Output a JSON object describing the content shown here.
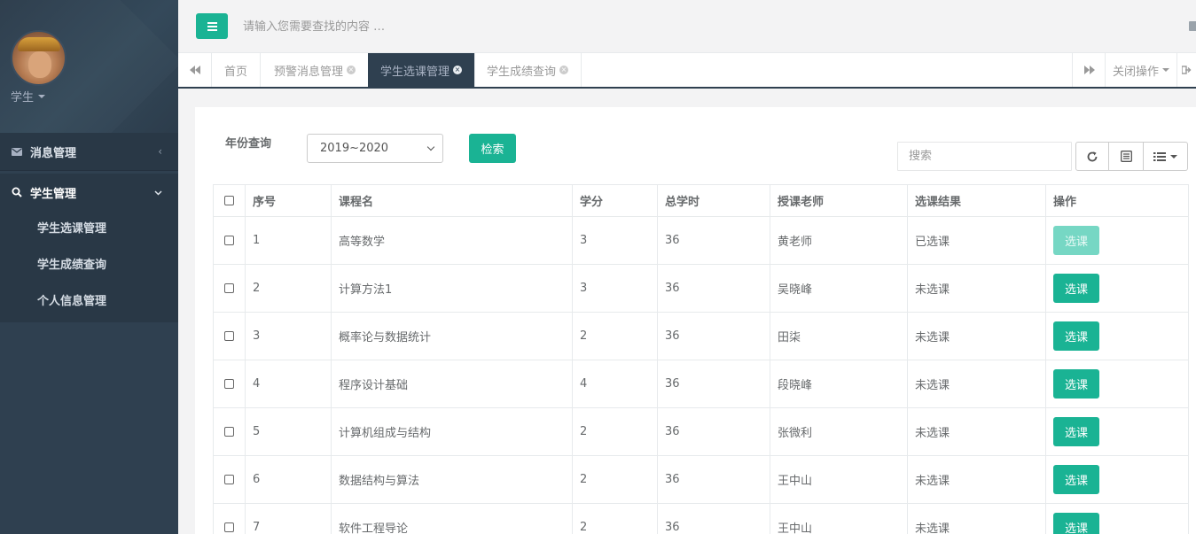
{
  "sidebar": {
    "role": "学生",
    "menu": [
      {
        "label": "消息管理",
        "arrow": "‹"
      },
      {
        "label": "学生管理",
        "arrow": "⌄"
      }
    ],
    "submenu": [
      "学生选课管理",
      "学生成绩查询",
      "个人信息管理"
    ]
  },
  "topbar": {
    "search_placeholder": "请输入您需要查找的内容 …"
  },
  "tabs": {
    "items": [
      "首页",
      "预警消息管理",
      "学生选课管理",
      "学生成绩查询"
    ],
    "active_index": 2,
    "close_ops": "关闭操作"
  },
  "filter": {
    "year_label": "年份查询",
    "year_value": "2019~2020",
    "search_button": "检索",
    "table_search_placeholder": "搜索"
  },
  "table": {
    "headers": [
      "序号",
      "课程名",
      "学分",
      "总学时",
      "授课老师",
      "选课结果",
      "操作"
    ],
    "action_label": "选课",
    "rows": [
      {
        "no": "1",
        "course": "高等数学",
        "credit": "3",
        "hours": "36",
        "teacher": "黄老师",
        "result": "已选课",
        "disabled": true
      },
      {
        "no": "2",
        "course": "计算方法1",
        "credit": "3",
        "hours": "36",
        "teacher": "吴晓峰",
        "result": "未选课",
        "disabled": false
      },
      {
        "no": "3",
        "course": "概率论与数据统计",
        "credit": "2",
        "hours": "36",
        "teacher": "田柒",
        "result": "未选课",
        "disabled": false
      },
      {
        "no": "4",
        "course": "程序设计基础",
        "credit": "4",
        "hours": "36",
        "teacher": "段晓峰",
        "result": "未选课",
        "disabled": false
      },
      {
        "no": "5",
        "course": "计算机组成与结构",
        "credit": "2",
        "hours": "36",
        "teacher": "张微利",
        "result": "未选课",
        "disabled": false
      },
      {
        "no": "6",
        "course": "数据结构与算法",
        "credit": "2",
        "hours": "36",
        "teacher": "王中山",
        "result": "未选课",
        "disabled": false
      },
      {
        "no": "7",
        "course": "软件工程导论",
        "credit": "2",
        "hours": "36",
        "teacher": "王中山",
        "result": "未选课",
        "disabled": false
      }
    ]
  },
  "colors": {
    "primary": "#1ab394",
    "sidebar": "#2f4050",
    "sidebar_dark": "#293846"
  }
}
